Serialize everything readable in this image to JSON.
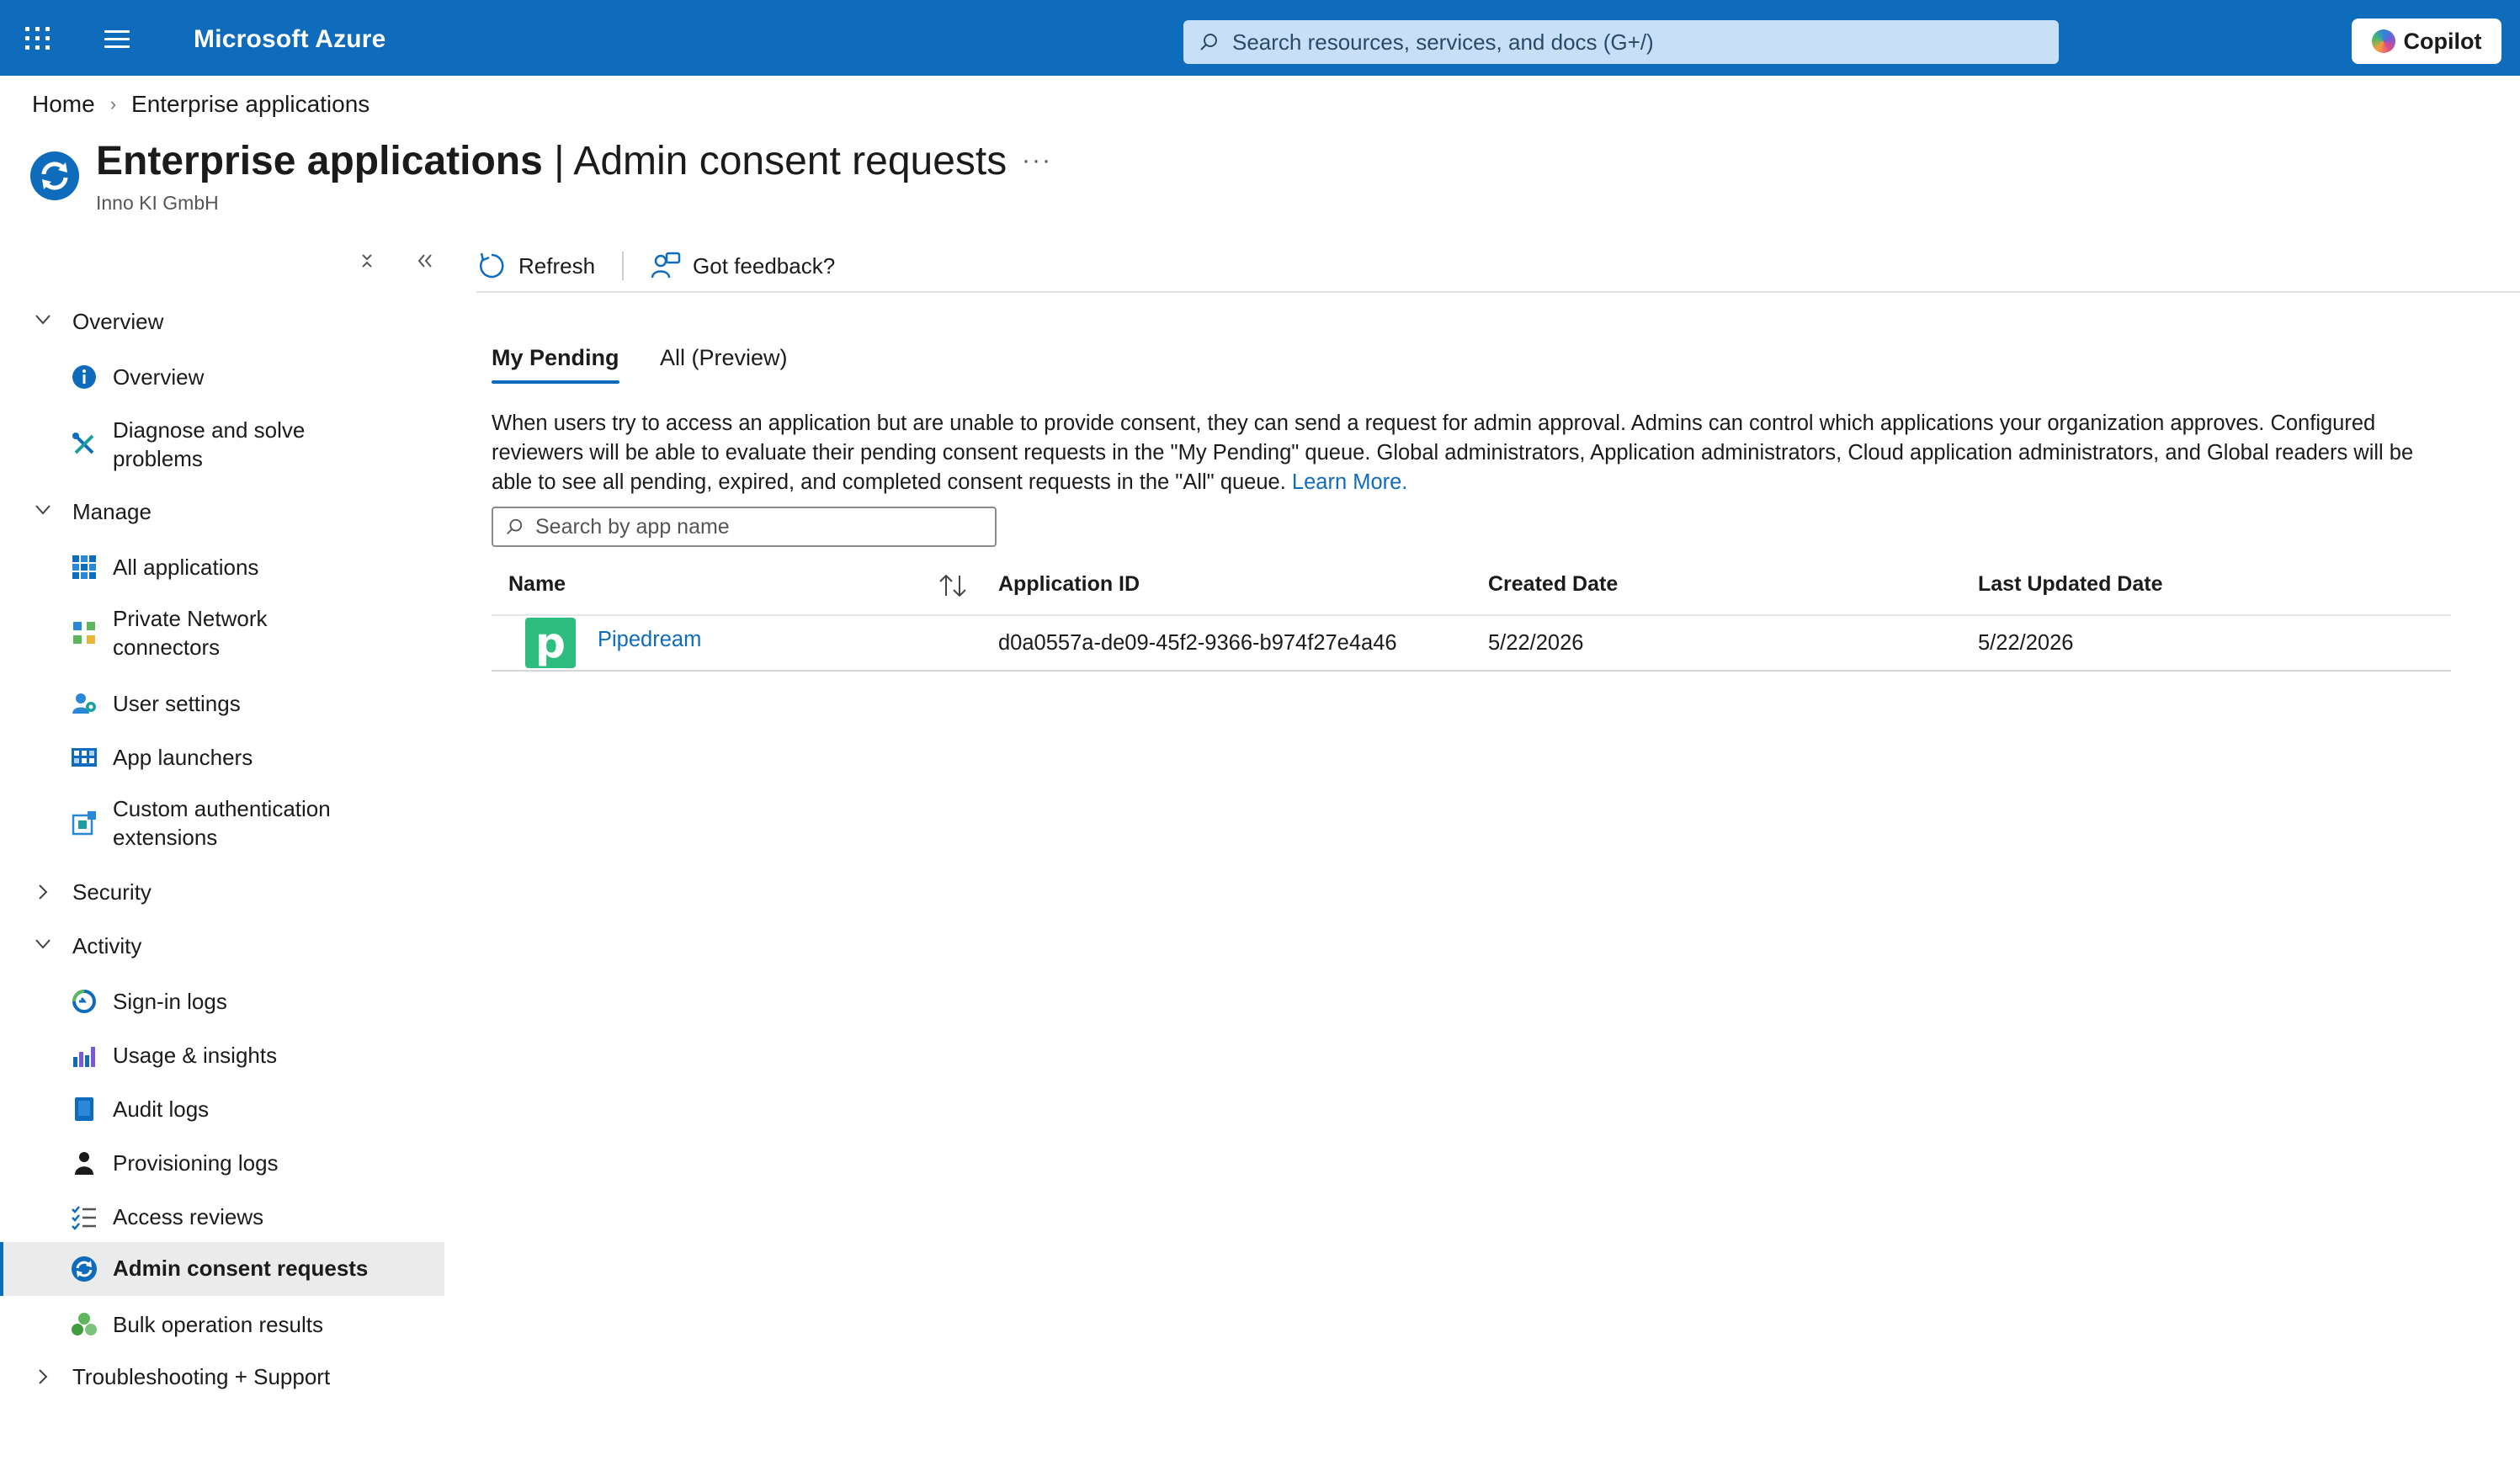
{
  "topbar": {
    "brand": "Microsoft Azure",
    "search_placeholder": "Search resources, services, and docs (G+/)",
    "copilot_label": "Copilot"
  },
  "breadcrumb": [
    "Home",
    "Enterprise applications"
  ],
  "header": {
    "title_bold": "Enterprise applications",
    "title_rest": " | Admin consent requests",
    "more": "···",
    "subtitle": "Inno KI GmbH"
  },
  "sidebar": {
    "groups": {
      "overview": "Overview",
      "manage": "Manage",
      "security": "Security",
      "activity": "Activity",
      "troubleshooting": "Troubleshooting + Support"
    },
    "items": {
      "overview": "Overview",
      "diagnose_1": "Diagnose and solve",
      "diagnose_2": "problems",
      "all_apps": "All applications",
      "private_1": "Private Network",
      "private_2": "connectors",
      "user_settings": "User settings",
      "app_launchers": "App launchers",
      "custom_1": "Custom authentication",
      "custom_2": "extensions",
      "signin": "Sign-in logs",
      "usage": "Usage & insights",
      "audit": "Audit logs",
      "provisioning": "Provisioning logs",
      "access_reviews": "Access reviews",
      "admin_consent": "Admin consent requests",
      "bulk": "Bulk operation results"
    }
  },
  "toolbar": {
    "refresh": "Refresh",
    "feedback": "Got feedback?"
  },
  "tabs": {
    "my_pending": "My Pending",
    "all": "All (Preview)"
  },
  "description": {
    "text": "When users try to access an application but are unable to provide consent, they can send a request for admin approval. Admins can control which applications your organization approves. Configured reviewers will be able to evaluate their pending consent requests in the \"My Pending\" queue. Global administrators, Application administrators, Cloud application administrators, and Global readers will be able to see all pending, expired, and completed consent requests in the \"All\" queue. ",
    "link": "Learn More."
  },
  "search": {
    "placeholder": "Search by app name"
  },
  "table": {
    "columns": {
      "name": "Name",
      "app_id": "Application ID",
      "created": "Created Date",
      "updated": "Last Updated Date"
    },
    "rows": [
      {
        "logo_letter": "p",
        "name": "Pipedream",
        "app_id": "d0a0557a-de09-45f2-9366-b974f27e4a46",
        "created": "5/22/2026",
        "updated": "5/22/2026"
      }
    ]
  },
  "colors": {
    "brand_blue": "#0f6cbd",
    "pipedream_green": "#2dbd7e"
  }
}
